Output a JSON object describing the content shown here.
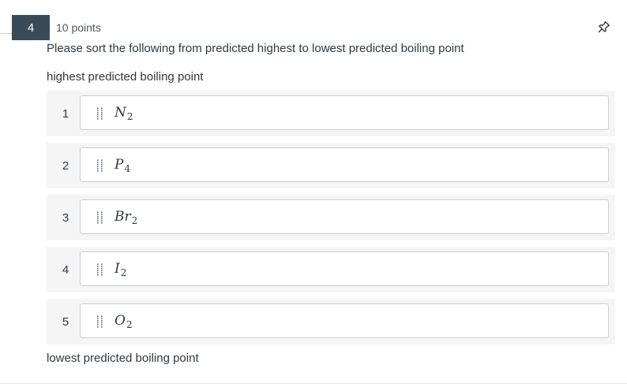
{
  "question": {
    "number": "4",
    "points": "10 points",
    "prompt": "Please sort the following from predicted highest to lowest predicted boiling point",
    "top_label": "highest predicted boiling point",
    "bottom_label": "lowest predicted boiling point"
  },
  "items": [
    {
      "position": "1",
      "symbol": "N",
      "subscript": "2"
    },
    {
      "position": "2",
      "symbol": "P",
      "subscript": "4"
    },
    {
      "position": "3",
      "symbol": "Br",
      "subscript": "2"
    },
    {
      "position": "4",
      "symbol": "I",
      "subscript": "2"
    },
    {
      "position": "5",
      "symbol": "O",
      "subscript": "2"
    }
  ],
  "icons": {
    "pin": "pin-icon",
    "grip": "drag-handle-icon"
  },
  "colors": {
    "question_badge": "#394b58",
    "row_background": "#f5f5f5",
    "card_border": "#c7cdd1",
    "text": "#2d3b45"
  }
}
